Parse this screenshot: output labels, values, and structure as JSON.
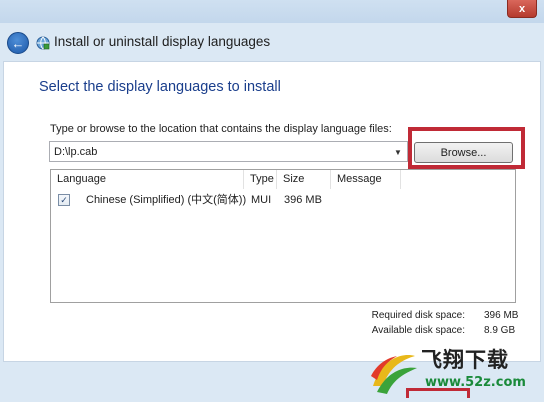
{
  "window": {
    "close_glyph": "x"
  },
  "header": {
    "title": "Install or uninstall display languages",
    "back_icon": "back-arrow-icon",
    "app_icon": "language-globe-icon"
  },
  "main": {
    "heading": "Select the display languages to install",
    "path_label": "Type or browse to the location that contains the display language files:",
    "path_value": "D:\\lp.cab",
    "browse_label": "Browse...",
    "table": {
      "columns": [
        "Language",
        "Type",
        "Size",
        "Message"
      ],
      "rows": [
        {
          "checked": true,
          "checkmark": "✓",
          "language": "Chinese (Simplified) (中文(简体))",
          "type": "MUI",
          "size": "396 MB",
          "message": ""
        }
      ]
    },
    "disk": {
      "required_label": "Required disk space:",
      "required_value": "396 MB",
      "available_label": "Available disk space:",
      "available_value": "8.9 GB"
    }
  },
  "colors": {
    "heading": "#1a3e8c",
    "highlight": "#c02a36",
    "chrome": "#dbe8f4"
  },
  "watermark": {
    "brand": "飞翔下载",
    "url": "www.52z.com"
  }
}
